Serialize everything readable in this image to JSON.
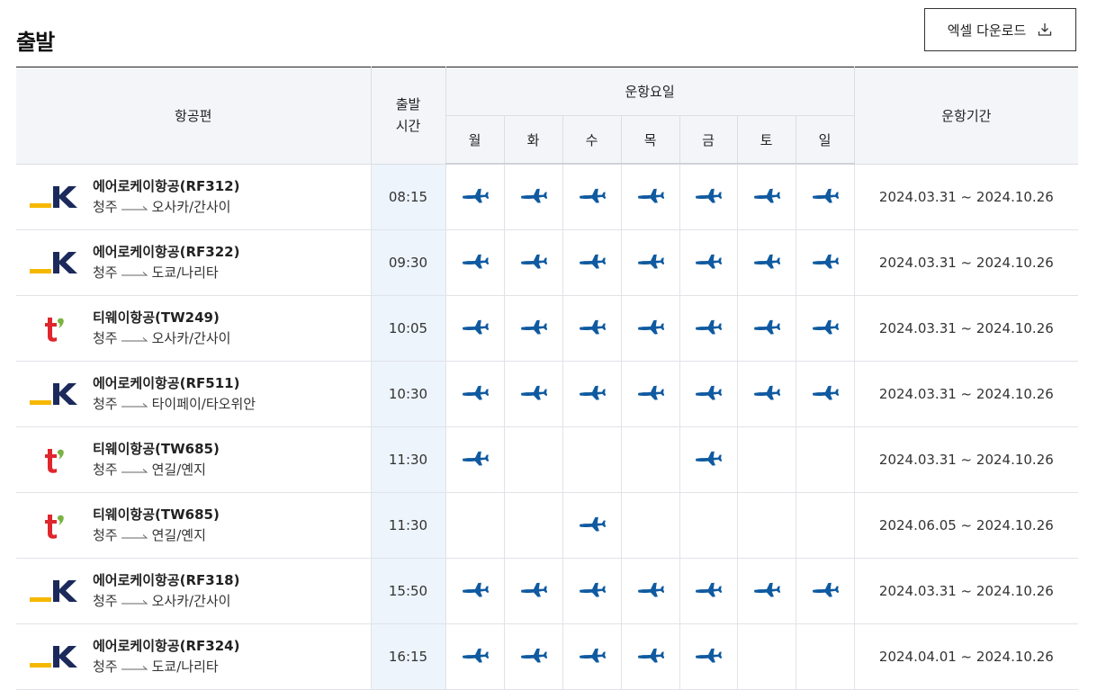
{
  "page": {
    "title": "출발",
    "excel_button_label": "엑셀 다운로드"
  },
  "table": {
    "headers": {
      "flight": "항공편",
      "time": "출발\n시간",
      "days_group": "운항요일",
      "period": "운항기간",
      "days": [
        "월",
        "화",
        "수",
        "목",
        "금",
        "토",
        "일"
      ]
    },
    "rows": [
      {
        "airline": "에어로케이항공(RF312)",
        "logo": "aerok",
        "origin": "청주",
        "dest": "오사카/간사이",
        "time": "08:15",
        "days": [
          1,
          1,
          1,
          1,
          1,
          1,
          1
        ],
        "period": "2024.03.31 ~ 2024.10.26"
      },
      {
        "airline": "에어로케이항공(RF322)",
        "logo": "aerok",
        "origin": "청주",
        "dest": "도쿄/나리타",
        "time": "09:30",
        "days": [
          1,
          1,
          1,
          1,
          1,
          1,
          1
        ],
        "period": "2024.03.31 ~ 2024.10.26"
      },
      {
        "airline": "티웨이항공(TW249)",
        "logo": "tway",
        "origin": "청주",
        "dest": "오사카/간사이",
        "time": "10:05",
        "days": [
          1,
          1,
          1,
          1,
          1,
          1,
          1
        ],
        "period": "2024.03.31 ~ 2024.10.26"
      },
      {
        "airline": "에어로케이항공(RF511)",
        "logo": "aerok",
        "origin": "청주",
        "dest": "타이페이/타오위안",
        "time": "10:30",
        "days": [
          1,
          1,
          1,
          1,
          1,
          1,
          1
        ],
        "period": "2024.03.31 ~ 2024.10.26"
      },
      {
        "airline": "티웨이항공(TW685)",
        "logo": "tway",
        "origin": "청주",
        "dest": "연길/옌지",
        "time": "11:30",
        "days": [
          1,
          0,
          0,
          0,
          1,
          0,
          0
        ],
        "period": "2024.03.31 ~ 2024.10.26"
      },
      {
        "airline": "티웨이항공(TW685)",
        "logo": "tway",
        "origin": "청주",
        "dest": "연길/옌지",
        "time": "11:30",
        "days": [
          0,
          0,
          1,
          0,
          0,
          0,
          0
        ],
        "period": "2024.06.05 ~ 2024.10.26"
      },
      {
        "airline": "에어로케이항공(RF318)",
        "logo": "aerok",
        "origin": "청주",
        "dest": "오사카/간사이",
        "time": "15:50",
        "days": [
          1,
          1,
          1,
          1,
          1,
          1,
          1
        ],
        "period": "2024.03.31 ~ 2024.10.26"
      },
      {
        "airline": "에어로케이항공(RF324)",
        "logo": "aerok",
        "origin": "청주",
        "dest": "도쿄/나리타",
        "time": "16:15",
        "days": [
          1,
          1,
          1,
          1,
          1,
          0,
          0
        ],
        "period": "2024.04.01 ~ 2024.10.26"
      }
    ]
  },
  "icons": {
    "plane": "plane-icon",
    "download": "download-icon",
    "route_arrow": "arrow-right-icon"
  },
  "colors": {
    "plane": "#0f5aa0",
    "time_column_bg": "#edf4fc",
    "header_bg": "#f4f5f9",
    "aerok_navy": "#1b2a5b",
    "aerok_yellow": "#f5b800",
    "tway_red": "#e0262d",
    "tway_green": "#7ab342"
  }
}
